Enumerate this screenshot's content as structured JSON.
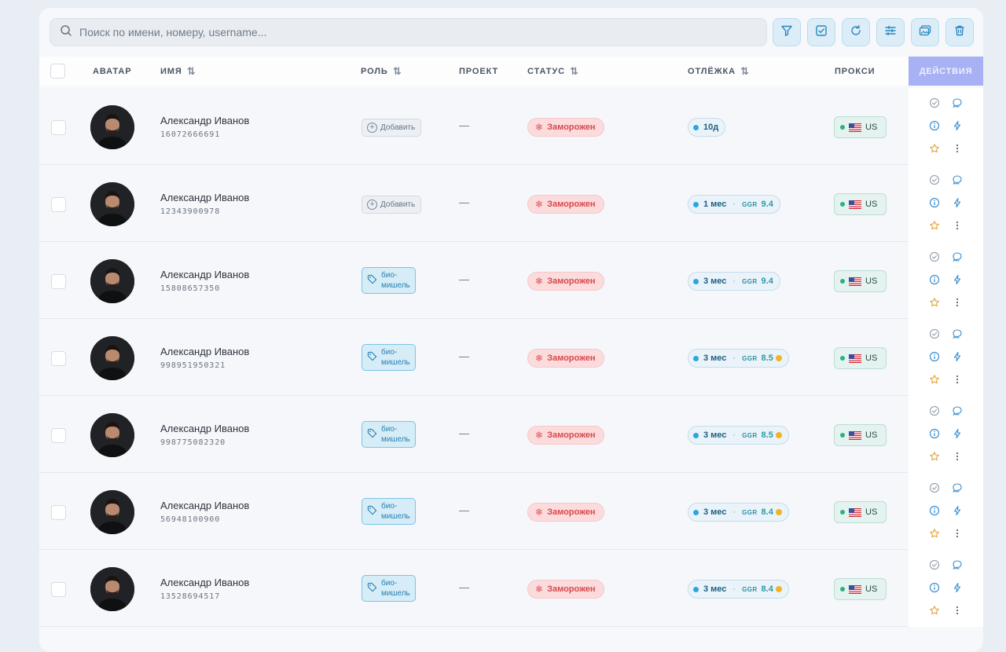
{
  "search": {
    "placeholder": "Поиск по имени, номеру, username...",
    "value": ""
  },
  "toolbar": {
    "buttons": [
      "filter-icon",
      "check-square-icon",
      "refresh-icon",
      "sliders-icon",
      "image-icon",
      "trash-icon"
    ]
  },
  "table": {
    "headers": {
      "avatar": "АВАТАР",
      "name": "ИМЯ",
      "role": "РОЛЬ",
      "project": "ПРОЕКТ",
      "status": "СТАТУС",
      "rest": "ОТЛЁЖКА",
      "proxy": "ПРОКСИ",
      "actions": "ДЕЙСТВИЯ"
    },
    "sort_glyph": "⇅",
    "rows": [
      {
        "name": "Александр Иванов",
        "phone": "16072666691",
        "role": "Добавить",
        "role_type": "add",
        "project": "—",
        "status": "Заморожен",
        "rest": "10д",
        "ggr_label": "",
        "ggr": "",
        "coin": false,
        "proxy": "US"
      },
      {
        "name": "Александр Иванов",
        "phone": "12343900978",
        "role": "Добавить",
        "role_type": "add",
        "project": "—",
        "status": "Заморожен",
        "rest": "1 мес",
        "ggr_label": "GGR",
        "ggr": "9.4",
        "coin": false,
        "proxy": "US"
      },
      {
        "name": "Александр Иванов",
        "phone": "15808657350",
        "role": "био-мишель",
        "role_type": "tag",
        "project": "—",
        "status": "Заморожен",
        "rest": "3 мес",
        "ggr_label": "GGR",
        "ggr": "9.4",
        "coin": false,
        "proxy": "US"
      },
      {
        "name": "Александр Иванов",
        "phone": "998951950321",
        "role": "био-мишель",
        "role_type": "tag",
        "project": "—",
        "status": "Заморожен",
        "rest": "3 мес",
        "ggr_label": "GGR",
        "ggr": "8.5",
        "coin": true,
        "proxy": "US"
      },
      {
        "name": "Александр Иванов",
        "phone": "998775082320",
        "role": "био-мишель",
        "role_type": "tag",
        "project": "—",
        "status": "Заморожен",
        "rest": "3 мес",
        "ggr_label": "GGR",
        "ggr": "8.5",
        "coin": true,
        "proxy": "US"
      },
      {
        "name": "Александр Иванов",
        "phone": "56948100900",
        "role": "био-мишель",
        "role_type": "tag",
        "project": "—",
        "status": "Заморожен",
        "rest": "3 мес",
        "ggr_label": "GGR",
        "ggr": "8.4",
        "coin": true,
        "proxy": "US"
      },
      {
        "name": "Александр Иванов",
        "phone": "13528694517",
        "role": "био-мишель",
        "role_type": "tag",
        "project": "—",
        "status": "Заморожен",
        "rest": "3 мес",
        "ggr_label": "GGR",
        "ggr": "8.4",
        "coin": true,
        "proxy": "US"
      }
    ]
  },
  "colors": {
    "accent": "#a7b1f4",
    "frozen": "#d9494c",
    "proxy_ok": "#2fb07d",
    "star": "#e2a23a"
  }
}
